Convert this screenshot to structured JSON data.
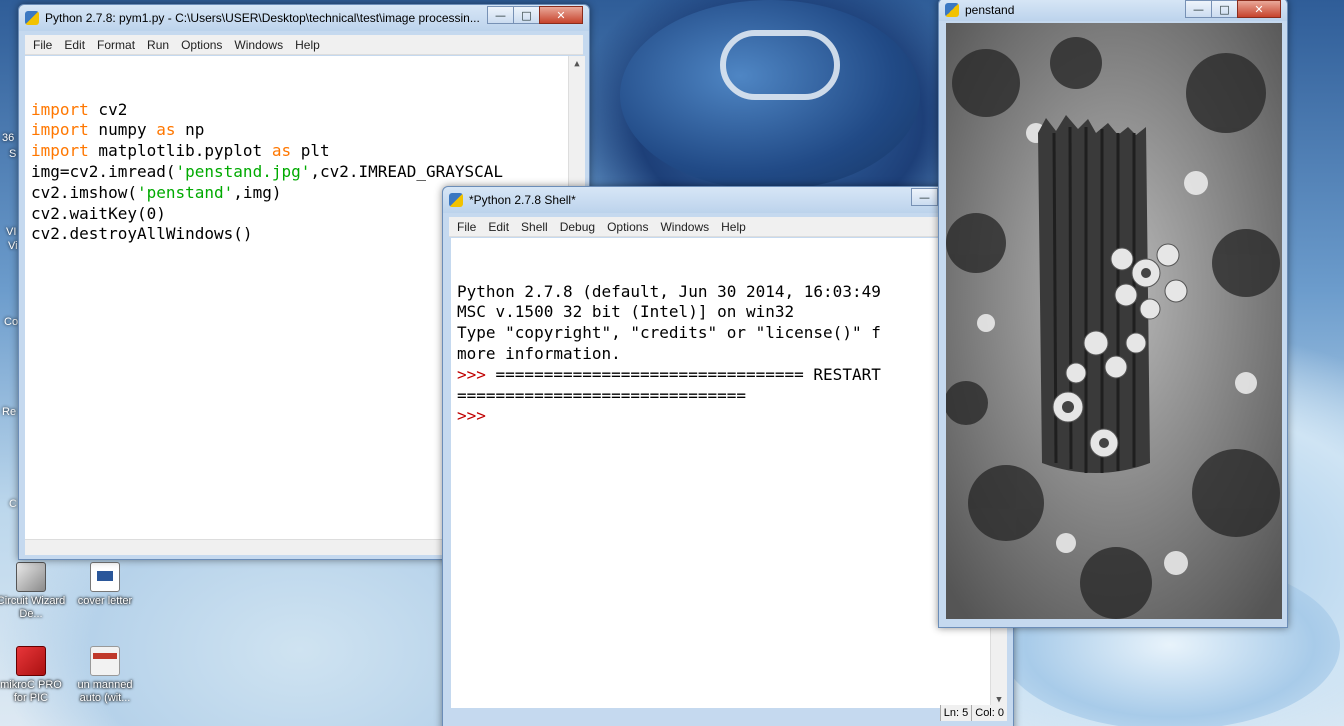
{
  "desktop": {
    "icons": [
      {
        "label": "Circuit Wizard De...",
        "icon": "circuit-wizard-icon"
      },
      {
        "label": "cover letter",
        "icon": "word-document-icon"
      },
      {
        "label": "mikroC PRO for PIC",
        "icon": "mikroc-icon"
      },
      {
        "label": "un manned auto (wit...",
        "icon": "document-icon"
      }
    ],
    "edge_fragments": [
      "36",
      "S",
      "VI",
      "Vi",
      "Co",
      "Re",
      "C"
    ]
  },
  "editor_window": {
    "title": "Python 2.7.8: pym1.py - C:\\Users\\USER\\Desktop\\technical\\test\\image processin...",
    "menu": [
      "File",
      "Edit",
      "Format",
      "Run",
      "Options",
      "Windows",
      "Help"
    ],
    "code_lines": [
      [
        {
          "t": "import",
          "k": "kw"
        },
        {
          "t": " cv2",
          "k": ""
        }
      ],
      [
        {
          "t": "import",
          "k": "kw"
        },
        {
          "t": " numpy ",
          "k": ""
        },
        {
          "t": "as",
          "k": "kw"
        },
        {
          "t": " np",
          "k": ""
        }
      ],
      [
        {
          "t": "import",
          "k": "kw"
        },
        {
          "t": " matplotlib.pyplot ",
          "k": ""
        },
        {
          "t": "as",
          "k": "kw"
        },
        {
          "t": " plt",
          "k": ""
        }
      ],
      [
        {
          "t": "img=cv2.imread(",
          "k": ""
        },
        {
          "t": "'penstand.jpg'",
          "k": "str"
        },
        {
          "t": ",cv2.IMREAD_GRAYSCAL",
          "k": ""
        }
      ],
      [
        {
          "t": "cv2.imshow(",
          "k": ""
        },
        {
          "t": "'penstand'",
          "k": "str"
        },
        {
          "t": ",img)",
          "k": ""
        }
      ],
      [
        {
          "t": "cv2.waitKey(0)",
          "k": ""
        }
      ],
      [
        {
          "t": "cv2.destroyAllWindows()",
          "k": ""
        }
      ]
    ]
  },
  "shell_window": {
    "title": "*Python 2.7.8 Shell*",
    "menu": [
      "File",
      "Edit",
      "Shell",
      "Debug",
      "Options",
      "Windows",
      "Help"
    ],
    "lines": [
      [
        {
          "t": "Python 2.7.8 (default, Jun 30 2014, 16:03:49",
          "k": ""
        }
      ],
      [
        {
          "t": "MSC v.1500 32 bit (Intel)] on win32",
          "k": ""
        }
      ],
      [
        {
          "t": "Type \"copyright\", \"credits\" or \"license()\" f",
          "k": ""
        }
      ],
      [
        {
          "t": "more information.",
          "k": ""
        }
      ],
      [
        {
          "t": ">>> ",
          "k": "prompt"
        },
        {
          "t": "================================ RESTART",
          "k": ""
        }
      ],
      [
        {
          "t": "==============================",
          "k": ""
        }
      ],
      [
        {
          "t": ">>> ",
          "k": "prompt"
        }
      ]
    ],
    "status_line": "Ln: 5",
    "status_col": "Col: 0"
  },
  "image_window": {
    "title": "penstand"
  },
  "colors": {
    "keyword": "#ff7700",
    "string": "#00aa00",
    "prompt": "#c00000",
    "titlebar": "#c5d9ef"
  }
}
